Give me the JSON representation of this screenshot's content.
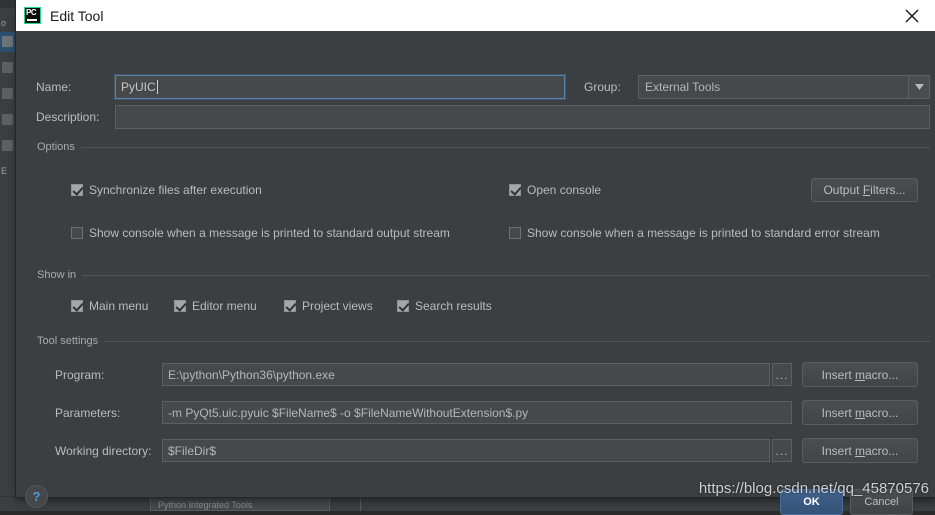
{
  "window": {
    "title": "Edit Tool",
    "app_icon": "pycharm-icon",
    "close_icon": "close-icon"
  },
  "form": {
    "name_label": "Name:",
    "name_value": "PyUIC",
    "description_label": "Description:",
    "description_value": "",
    "group_label": "Group:",
    "group_value": "External Tools",
    "group_arrow_icon": "chevron-down-icon"
  },
  "options": {
    "title": "Options",
    "checkboxes": [
      {
        "label": "Synchronize files after execution",
        "checked": true
      },
      {
        "label": "Open console",
        "checked": true
      },
      {
        "label": "Show console when a message is printed to standard output stream",
        "checked": false
      },
      {
        "label": "Show console when a message is printed to standard error stream",
        "checked": false
      }
    ],
    "output_filters_label_pre": "Output ",
    "output_filters_mnemonic": "F",
    "output_filters_label_post": "ilters..."
  },
  "show_in": {
    "title": "Show in",
    "checkboxes": [
      {
        "label": "Main menu",
        "checked": true
      },
      {
        "label": "Editor menu",
        "checked": true
      },
      {
        "label": "Project views",
        "checked": true
      },
      {
        "label": "Search results",
        "checked": true
      }
    ]
  },
  "tool_settings": {
    "title": "Tool settings",
    "program_label": "Program:",
    "program_value": "E:\\python\\Python36\\python.exe",
    "parameters_label": "Parameters:",
    "parameters_value": "-m PyQt5.uic.pyuic  $FileName$ -o $FileNameWithoutExtension$.py",
    "working_directory_label": "Working directory:",
    "working_directory_value": "$FileDir$",
    "browse_label": "...",
    "insert_macro_pre": "Insert ",
    "insert_macro_mnemonic": "m",
    "insert_macro_post": "acro..."
  },
  "footer": {
    "help_label": "?",
    "ok_label": "OK",
    "cancel_label": "Cancel"
  },
  "overlay": {
    "watermark": "https://blog.csdn.net/qq_45870576"
  },
  "background": {
    "rail_letters": [
      "o",
      "E"
    ],
    "bottom_panel_label": "Python Integrated Tools"
  },
  "colors": {
    "dialog_bg": "#3c3f41",
    "field_bg": "#45494a",
    "accent_blue": "#3f618c",
    "text": "#bbbbbb",
    "titlebar_bg": "#ffffff",
    "icon_green": "#21d789"
  }
}
